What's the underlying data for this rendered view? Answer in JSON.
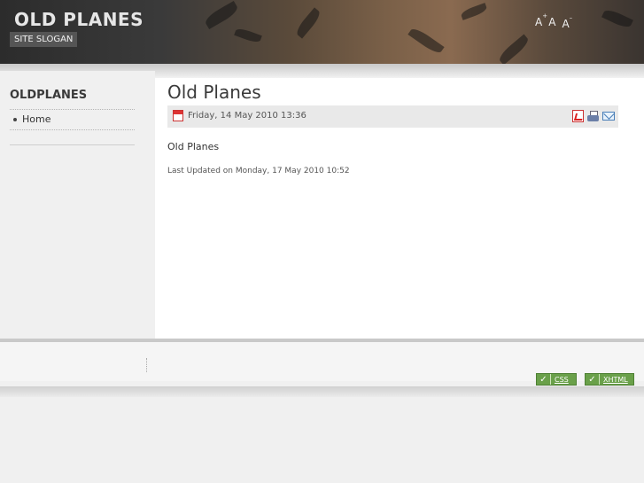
{
  "header": {
    "site_title": "OLD PLANES",
    "site_slogan": "SITE SLOGAN",
    "font_size": {
      "increase_label": "A",
      "increase_mark": "+",
      "reset_label": "A",
      "decrease_label": "A",
      "decrease_mark": "–"
    }
  },
  "sidebar": {
    "title": "OLDPLANES",
    "items": [
      {
        "label": "Home"
      }
    ]
  },
  "article": {
    "title": "Old Planes",
    "created": "Friday, 14 May 2010 13:36",
    "body": "Old Planes",
    "last_updated": "Last Updated on Monday, 17 May 2010 10:52",
    "icons": [
      "calendar-icon",
      "pdf-icon",
      "print-icon",
      "email-icon"
    ]
  },
  "footer": {
    "badges": [
      {
        "check": "✓",
        "label": "CSS"
      },
      {
        "check": "✓",
        "label": "XHTML"
      }
    ]
  },
  "colors": {
    "header_bg": "#3a3a3a",
    "main_bg": "#ffffff",
    "sidebar_bg": "#f0f0f0",
    "badge_green": "#6aa04a"
  }
}
